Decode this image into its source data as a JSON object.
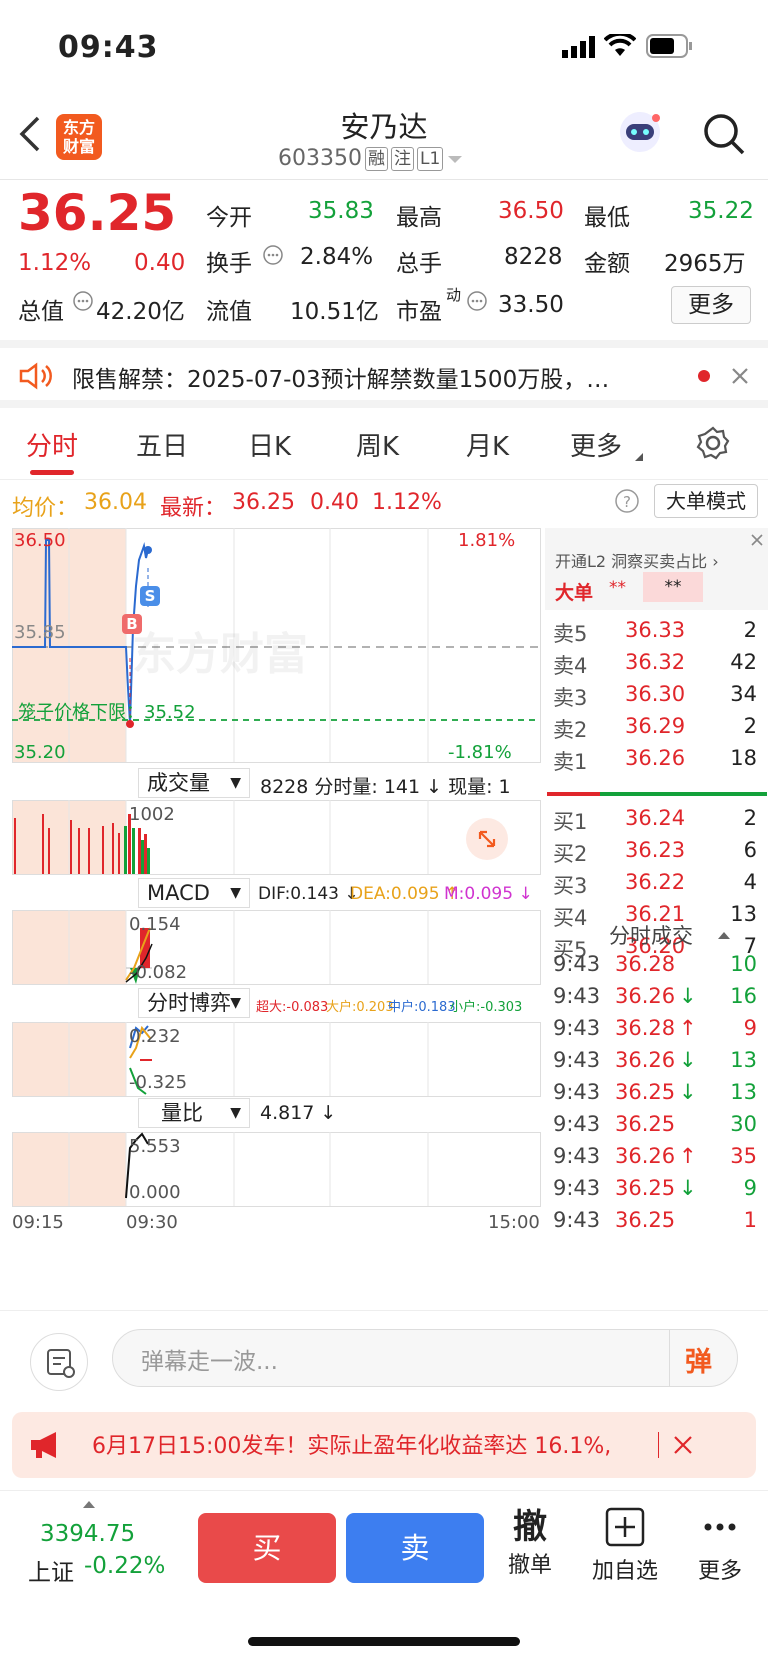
{
  "status": {
    "time": "09:43"
  },
  "header": {
    "title": "安乃达",
    "code": "603350",
    "tags": [
      "融",
      "注",
      "L1"
    ],
    "logo_l1": "东方",
    "logo_l2": "财富"
  },
  "quote": {
    "price": "36.25",
    "pct": "1.12%",
    "change": "0.40",
    "open_label": "今开",
    "open": "35.83",
    "high_label": "最高",
    "high": "36.50",
    "low_label": "最低",
    "low": "35.22",
    "turnover_label": "换手",
    "turnover": "2.84%",
    "vol_label": "总手",
    "vol": "8228",
    "amount_label": "金额",
    "amount": "2965万",
    "mktcap_label": "总值",
    "mktcap": "42.20亿",
    "float_label": "流值",
    "float": "10.51亿",
    "pe_label": "市盈",
    "pe_sup": "动",
    "pe": "33.50",
    "more": "更多"
  },
  "notice": {
    "text": "限售解禁：2025-07-03预计解禁数量1500万股，…"
  },
  "tabs": [
    {
      "label": "分时"
    },
    {
      "label": "五日"
    },
    {
      "label": "日K"
    },
    {
      "label": "周K"
    },
    {
      "label": "月K"
    },
    {
      "label": "更多"
    }
  ],
  "avgline": {
    "avg_label": "均价：",
    "avg": "36.04",
    "last_label": "最新：",
    "last": "36.25",
    "chg": "0.40",
    "pct": "1.12%",
    "mode_btn": "大单模式"
  },
  "chart": {
    "price_top": "36.50",
    "price_bottom": "35.20",
    "pct_top": "1.81%",
    "pct_bottom": "-1.81%",
    "mid_price": "35.85",
    "cage_label": "笼子价格下限：35.52",
    "watermark": "东方财富",
    "marker_b": "B",
    "marker_s": "S",
    "vol_label": "成交量",
    "vol_text": "8228 分时量: 141 ↓ 现量: 1",
    "vol_axis": "1002",
    "macd_label": "MACD",
    "macd_dif": "DIF:0.143 ↓",
    "macd_dea": "DEA:0.095 ↑",
    "macd_m": "M:0.095 ↓",
    "macd_top": "0.154",
    "macd_bottom": "-0.082",
    "game_label": "分时博弈",
    "game_super": "超大:-0.083",
    "game_big": "大户:0.203",
    "game_mid": "中户:0.183",
    "game_small": "小户:-0.303",
    "game_top": "0.232",
    "game_bottom": "-0.325",
    "ratio_label": "量比",
    "ratio_text": "4.817 ↓",
    "ratio_top": "5.553",
    "ratio_bottom": "0.000",
    "t0": "09:15",
    "t1": "09:30",
    "t2": "15:00"
  },
  "panel": {
    "l2_text": "开通L2 洞察买卖占比 ›",
    "big_label": "大单",
    "big_val": "**",
    "big_val2": "**",
    "asks": [
      {
        "label": "卖5",
        "price": "36.33",
        "vol": "2"
      },
      {
        "label": "卖4",
        "price": "36.32",
        "vol": "42"
      },
      {
        "label": "卖3",
        "price": "36.30",
        "vol": "34"
      },
      {
        "label": "卖2",
        "price": "36.29",
        "vol": "2"
      },
      {
        "label": "卖1",
        "price": "36.26",
        "vol": "18"
      }
    ],
    "bids": [
      {
        "label": "买1",
        "price": "36.24",
        "vol": "2"
      },
      {
        "label": "买2",
        "price": "36.23",
        "vol": "6"
      },
      {
        "label": "买3",
        "price": "36.22",
        "vol": "4"
      },
      {
        "label": "买4",
        "price": "36.21",
        "vol": "13"
      },
      {
        "label": "买5",
        "price": "36.20",
        "vol": "7"
      }
    ],
    "ticks_title": "分时成交",
    "ticks": [
      {
        "t": "9:43",
        "p": "36.28",
        "a": "",
        "v": "10",
        "c": "red",
        "vc": "green"
      },
      {
        "t": "9:43",
        "p": "36.26",
        "a": "↓",
        "v": "16",
        "c": "red",
        "vc": "green"
      },
      {
        "t": "9:43",
        "p": "36.28",
        "a": "↑",
        "v": "9",
        "c": "red",
        "vc": "red"
      },
      {
        "t": "9:43",
        "p": "36.26",
        "a": "↓",
        "v": "13",
        "c": "red",
        "vc": "green"
      },
      {
        "t": "9:43",
        "p": "36.25",
        "a": "↓",
        "v": "13",
        "c": "red",
        "vc": "green"
      },
      {
        "t": "9:43",
        "p": "36.25",
        "a": "",
        "v": "30",
        "c": "red",
        "vc": "green"
      },
      {
        "t": "9:43",
        "p": "36.26",
        "a": "↑",
        "v": "35",
        "c": "red",
        "vc": "red"
      },
      {
        "t": "9:43",
        "p": "36.25",
        "a": "↓",
        "v": "9",
        "c": "red",
        "vc": "green"
      },
      {
        "t": "9:43",
        "p": "36.25",
        "a": "",
        "v": "1",
        "c": "red",
        "vc": "red"
      }
    ]
  },
  "comment": {
    "placeholder": "弹幕走一波...",
    "btn": "弹"
  },
  "promo": {
    "text": "6月17日15:00发车！实际止盈年化收益率达 16.1%,"
  },
  "bottom": {
    "index_val": "3394.75",
    "index_name": "上证",
    "index_pct": "-0.22%",
    "buy": "买",
    "sell": "卖",
    "cancel_glyph": "撤",
    "cancel": "撤单",
    "add": "加自选",
    "more": "更多"
  },
  "colors": {
    "red": "#e0262b",
    "green": "#13a13a",
    "orange": "#f25a1f",
    "buy_btn": "#e94a4a",
    "sell_btn": "#3d7ef0"
  }
}
